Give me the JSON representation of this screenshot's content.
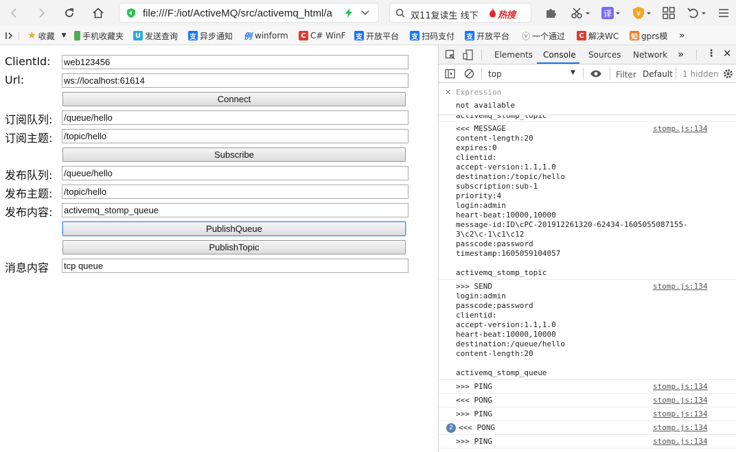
{
  "browser": {
    "address": "file:///F:/iot/ActiveMQ/src/activemq_html/a",
    "search_placeholder": "双11复读生 线下",
    "search_hot": "热搜"
  },
  "bookmarks": [
    {
      "label": "收藏",
      "icon": "star-icon",
      "color": "#f5a623"
    },
    {
      "label": "手机收藏夹",
      "icon": "phone-icon",
      "color": "#4caf50"
    },
    {
      "label": "发送查询",
      "icon": "u-icon",
      "color": "#2fa8e0"
    },
    {
      "label": "异步通知",
      "icon": "alipay-icon",
      "color": "#1677ff"
    },
    {
      "label": "winform",
      "icon": "example-icon",
      "color": "#2a7ae2"
    },
    {
      "label": "C# WinF",
      "icon": "csdn-icon",
      "color": "#e33a2f"
    },
    {
      "label": "开放平台",
      "icon": "alipay-icon",
      "color": "#1677ff"
    },
    {
      "label": "扫码支付",
      "icon": "alipay-icon",
      "color": "#1677ff"
    },
    {
      "label": "开放平台",
      "icon": "alipay-icon",
      "color": "#1677ff"
    },
    {
      "label": "一个通过",
      "icon": "page-icon",
      "color": "#888888"
    },
    {
      "label": "解决WC",
      "icon": "csdn-icon",
      "color": "#e33a2f"
    },
    {
      "label": "gprs模",
      "icon": "zhihu-icon",
      "color": "#f07c2a"
    }
  ],
  "form": {
    "clientid_label": "ClientId:",
    "clientid_value": "web123456",
    "url_label": "Url:",
    "url_value": "ws://localhost:61614",
    "connect_label": "Connect",
    "sub_queue_label": "订阅队列:",
    "sub_queue_value": "/queue/hello",
    "sub_topic_label": "订阅主题:",
    "sub_topic_value": "/topic/hello",
    "subscribe_label": "Subscribe",
    "pub_queue_label": "发布队列:",
    "pub_queue_value": "/queue/hello",
    "pub_topic_label": "发布主题:",
    "pub_topic_value": "/topic/hello",
    "pub_content_label": "发布内容:",
    "pub_content_value": "activemq_stomp_queue",
    "publish_queue_label": "PublishQueue",
    "publish_topic_label": "PublishTopic",
    "message_label": "消息内容",
    "message_value": "tcp queue"
  },
  "devtools": {
    "tabs": [
      "Elements",
      "Console",
      "Sources",
      "Network"
    ],
    "context": "top",
    "filter_placeholder": "Filter",
    "level": "Default",
    "hidden": "1 hidden",
    "expression_label": "Expression",
    "expression_value": "not available",
    "messages": [
      {
        "text": "activemq_stomp_topic",
        "src": ""
      },
      {
        "text": "<<< MESSAGE\ncontent-length:20\nexpires:0\nclientid:\naccept-version:1.1,1.0\ndestination:/topic/hello\nsubscription:sub-1\npriority:4\nlogin:admin\nheart-beat:10000,10000\nmessage-id:ID\\cPC-201912261320-62434-1605055087155-\n3\\c2\\c-1\\c1\\c12\npasscode:password\ntimestamp:1605059104057\n\nactivemq_stomp_topic",
        "src": "stomp.js:134"
      },
      {
        "text": ">>> SEND\nlogin:admin\npasscode:password\nclientid:\naccept-version:1.1,1.0\nheart-beat:10000,10000\ndestination:/queue/hello\ncontent-length:20\n\nactivemq_stomp_queue",
        "src": "stomp.js:134"
      },
      {
        "text": ">>> PING",
        "src": "stomp.js:134"
      },
      {
        "text": "<<< PONG",
        "src": "stomp.js:134"
      },
      {
        "text": ">>> PING",
        "src": "stomp.js:134"
      },
      {
        "text": "<<< PONG",
        "src": "stomp.js:134",
        "count": "2"
      },
      {
        "text": ">>> PING",
        "src": "stomp.js:134"
      }
    ]
  }
}
